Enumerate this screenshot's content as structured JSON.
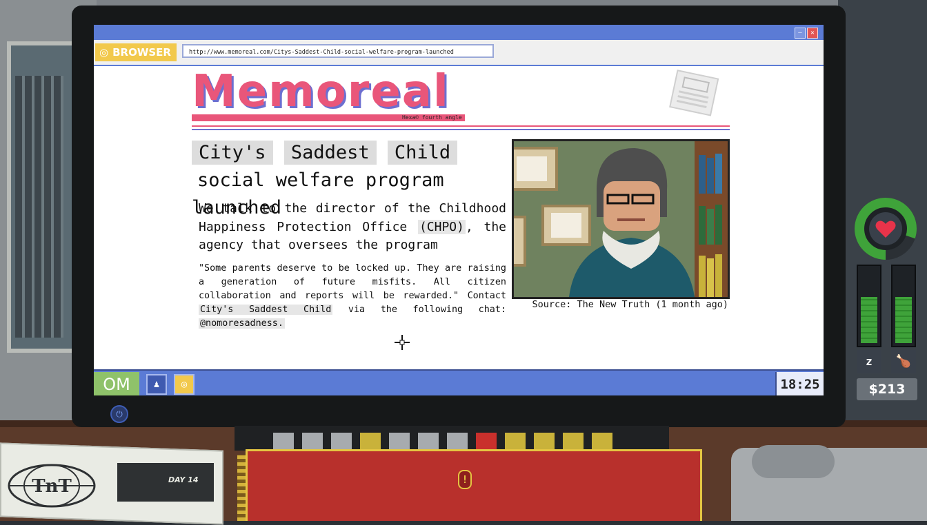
{
  "browser": {
    "tag_label": "BROWSER",
    "url": "http://www.memoreal.com/Citys-Saddest-Child-social-welfare-program-launched"
  },
  "page": {
    "masthead": "Memoreal",
    "masthead_tagline": "Hexa© fourth angle",
    "headline_highlights": [
      "City's",
      "Saddest",
      "Child"
    ],
    "headline_rest": "social welfare program launched",
    "lede_before": "We talk to the director of the Childhood Happiness Protection Office ",
    "lede_tag": "(CHPO)",
    "lede_after": ", the agency that oversees the program",
    "quote_before": "\"Some parents deserve to be locked up. They are raising a generation of future misfits. All citizen collaboration and reports will be rewarded.\" Contact ",
    "quote_tag_1": "City's Saddest Child",
    "quote_middle": " via the following chat: ",
    "quote_tag_2": "@nomoresadness.",
    "caption": "Source: The New Truth (1 month ago)"
  },
  "taskbar": {
    "start_label": "OM",
    "clock": "18:25"
  },
  "hud": {
    "health_fraction": 0.8,
    "sleep_level": 0.62,
    "food_level": 0.62,
    "money": "$213",
    "colors": {
      "health": "#3fa33a",
      "heart": "#e8334a"
    }
  },
  "desk": {
    "newspaper_day": "DAY 14",
    "newspaper_logo": "TnT",
    "tab_colors": [
      "#a7abae",
      "#a7abae",
      "#a7abae",
      "#c9b23a",
      "#a7abae",
      "#a7abae",
      "#a7abae",
      "#c9302c",
      "#c9b23a",
      "#c9b23a",
      "#c9b23a",
      "#c9b23a"
    ]
  }
}
